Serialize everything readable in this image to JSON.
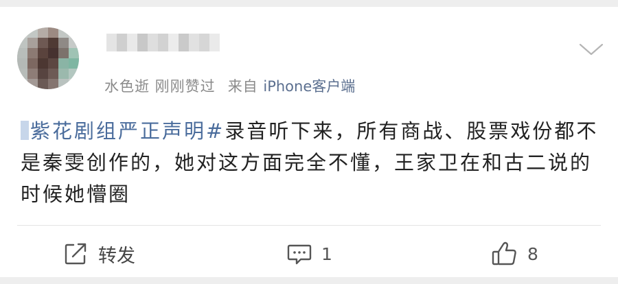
{
  "post": {
    "meta_text": "水色逝 刚刚赞过",
    "source_prefix": "来自",
    "source_client": "iPhone客户端",
    "topic": "#紫花剧组严正声明#",
    "topic_display": "紫花剧组严正声明#",
    "body_text": "录音听下来，所有商战、股票戏份都不是秦雯创作的，她对这方面完全不懂，王家卫在和古二说的时候她懵圈"
  },
  "actions": {
    "repost_label": "转发",
    "comment_count": "1",
    "like_count": "8"
  },
  "icons": {
    "menu": "chevron-down-icon",
    "repost": "repost-icon",
    "comment": "comment-icon",
    "like": "thumbs-up-icon"
  },
  "colors": {
    "topic_link": "#4a6c9c",
    "meta_text": "#8a8a8a",
    "source_link": "#5b6f8f"
  }
}
